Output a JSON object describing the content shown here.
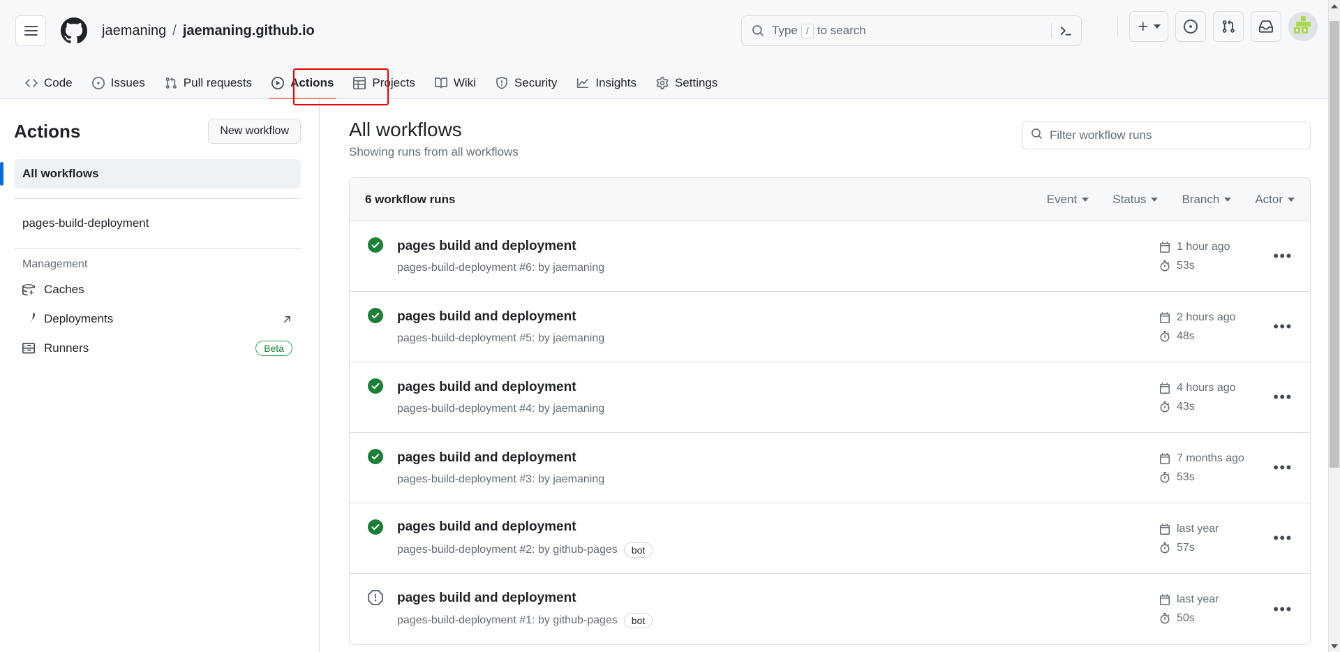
{
  "header": {
    "menu_icon": "hamburger-icon",
    "logo_icon": "github-logo-icon",
    "breadcrumb": {
      "owner": "jaemaning",
      "separator": "/",
      "repo": "jaemaning.github.io"
    },
    "search": {
      "icon": "search-icon",
      "placeholder_prefix": "Type",
      "placeholder_key": "/",
      "placeholder_suffix": "to search",
      "terminal_icon": "terminal-icon"
    },
    "actions": {
      "create_new_icon": "plus-icon",
      "issues_icon": "issue-opened-icon",
      "pull_requests_icon": "git-pull-request-icon",
      "notifications_icon": "inbox-icon",
      "avatar_icon": "user-avatar"
    }
  },
  "repo_nav": {
    "tabs": [
      {
        "label": "Code",
        "icon": "code-icon",
        "selected": false
      },
      {
        "label": "Issues",
        "icon": "issue-opened-icon",
        "selected": false
      },
      {
        "label": "Pull requests",
        "icon": "git-pull-request-icon",
        "selected": false
      },
      {
        "label": "Actions",
        "icon": "play-icon",
        "selected": true
      },
      {
        "label": "Projects",
        "icon": "table-icon",
        "selected": false
      },
      {
        "label": "Wiki",
        "icon": "book-icon",
        "selected": false
      },
      {
        "label": "Security",
        "icon": "shield-icon",
        "selected": false
      },
      {
        "label": "Insights",
        "icon": "graph-icon",
        "selected": false
      },
      {
        "label": "Settings",
        "icon": "gear-icon",
        "selected": false
      }
    ],
    "highlight_color": "#ee0000"
  },
  "sidebar": {
    "title": "Actions",
    "new_workflow_label": "New workflow",
    "all_workflows_label": "All workflows",
    "workflows": [
      {
        "label": "pages-build-deployment"
      }
    ],
    "management_label": "Management",
    "management_items": [
      {
        "label": "Caches",
        "icon": "cache-icon",
        "badge": "",
        "external": false
      },
      {
        "label": "Deployments",
        "icon": "rocket-icon",
        "badge": "",
        "external": true
      },
      {
        "label": "Runners",
        "icon": "server-icon",
        "badge": "Beta",
        "external": false
      }
    ],
    "active_accent": "#0969da"
  },
  "main": {
    "title": "All workflows",
    "subtitle": "Showing runs from all workflows",
    "filter_placeholder": "Filter workflow runs",
    "filter_icon": "search-icon",
    "runs_count_label": "6 workflow runs",
    "filters": [
      {
        "label": "Event"
      },
      {
        "label": "Status"
      },
      {
        "label": "Branch"
      },
      {
        "label": "Actor"
      }
    ],
    "runs": [
      {
        "status": "success",
        "status_icon": "check-circle-icon",
        "title": "pages build and deployment",
        "workflow": "pages-build-deployment",
        "number": "#6:",
        "by": "by jaemaning",
        "bot": "",
        "date_icon": "calendar-icon",
        "date": "1 hour ago",
        "duration_icon": "stopwatch-icon",
        "duration": "53s",
        "menu": "•••"
      },
      {
        "status": "success",
        "status_icon": "check-circle-icon",
        "title": "pages build and deployment",
        "workflow": "pages-build-deployment",
        "number": "#5:",
        "by": "by jaemaning",
        "bot": "",
        "date_icon": "calendar-icon",
        "date": "2 hours ago",
        "duration_icon": "stopwatch-icon",
        "duration": "48s",
        "menu": "•••"
      },
      {
        "status": "success",
        "status_icon": "check-circle-icon",
        "title": "pages build and deployment",
        "workflow": "pages-build-deployment",
        "number": "#4:",
        "by": "by jaemaning",
        "bot": "",
        "date_icon": "calendar-icon",
        "date": "4 hours ago",
        "duration_icon": "stopwatch-icon",
        "duration": "43s",
        "menu": "•••"
      },
      {
        "status": "success",
        "status_icon": "check-circle-icon",
        "title": "pages build and deployment",
        "workflow": "pages-build-deployment",
        "number": "#3:",
        "by": "by jaemaning",
        "bot": "",
        "date_icon": "calendar-icon",
        "date": "7 months ago",
        "duration_icon": "stopwatch-icon",
        "duration": "53s",
        "menu": "•••"
      },
      {
        "status": "success",
        "status_icon": "check-circle-icon",
        "title": "pages build and deployment",
        "workflow": "pages-build-deployment",
        "number": "#2:",
        "by": "by github-pages",
        "bot": "bot",
        "date_icon": "calendar-icon",
        "date": "last year",
        "duration_icon": "stopwatch-icon",
        "duration": "57s",
        "menu": "•••"
      },
      {
        "status": "skipped",
        "status_icon": "skip-icon",
        "title": "pages build and deployment",
        "workflow": "pages-build-deployment",
        "number": "#1:",
        "by": "by github-pages",
        "bot": "bot",
        "date_icon": "calendar-icon",
        "date": "last year",
        "duration_icon": "stopwatch-icon",
        "duration": "50s",
        "menu": "•••"
      }
    ]
  },
  "colors": {
    "success_green": "#1a7f37",
    "skipped_gray": "#636c76",
    "accent_blue": "#0969da",
    "selected_tab_underline": "#fd8c73"
  }
}
